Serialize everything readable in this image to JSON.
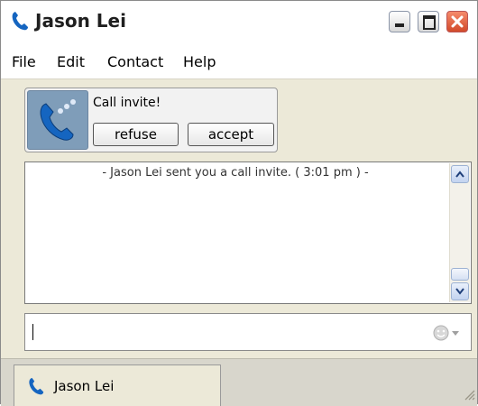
{
  "window": {
    "title": "Jason Lei"
  },
  "menu": {
    "items": [
      "File",
      "Edit",
      "Contact",
      "Help"
    ]
  },
  "invite": {
    "title": "Call invite!",
    "refuse_label": "refuse",
    "accept_label": "accept"
  },
  "log": {
    "message": "- Jason Lei sent you a call invite. ( 3:01 pm ) -"
  },
  "input": {
    "value": ""
  },
  "tabs": [
    {
      "label": "Jason Lei"
    }
  ],
  "icons": {
    "app": "phone-icon",
    "call": "phone-with-dots-icon",
    "emoji": "smiley-icon",
    "tab": "phone-icon"
  },
  "colors": {
    "accent": "#1565c0",
    "close": "#d24a2a",
    "panel": "#ece9d8"
  }
}
